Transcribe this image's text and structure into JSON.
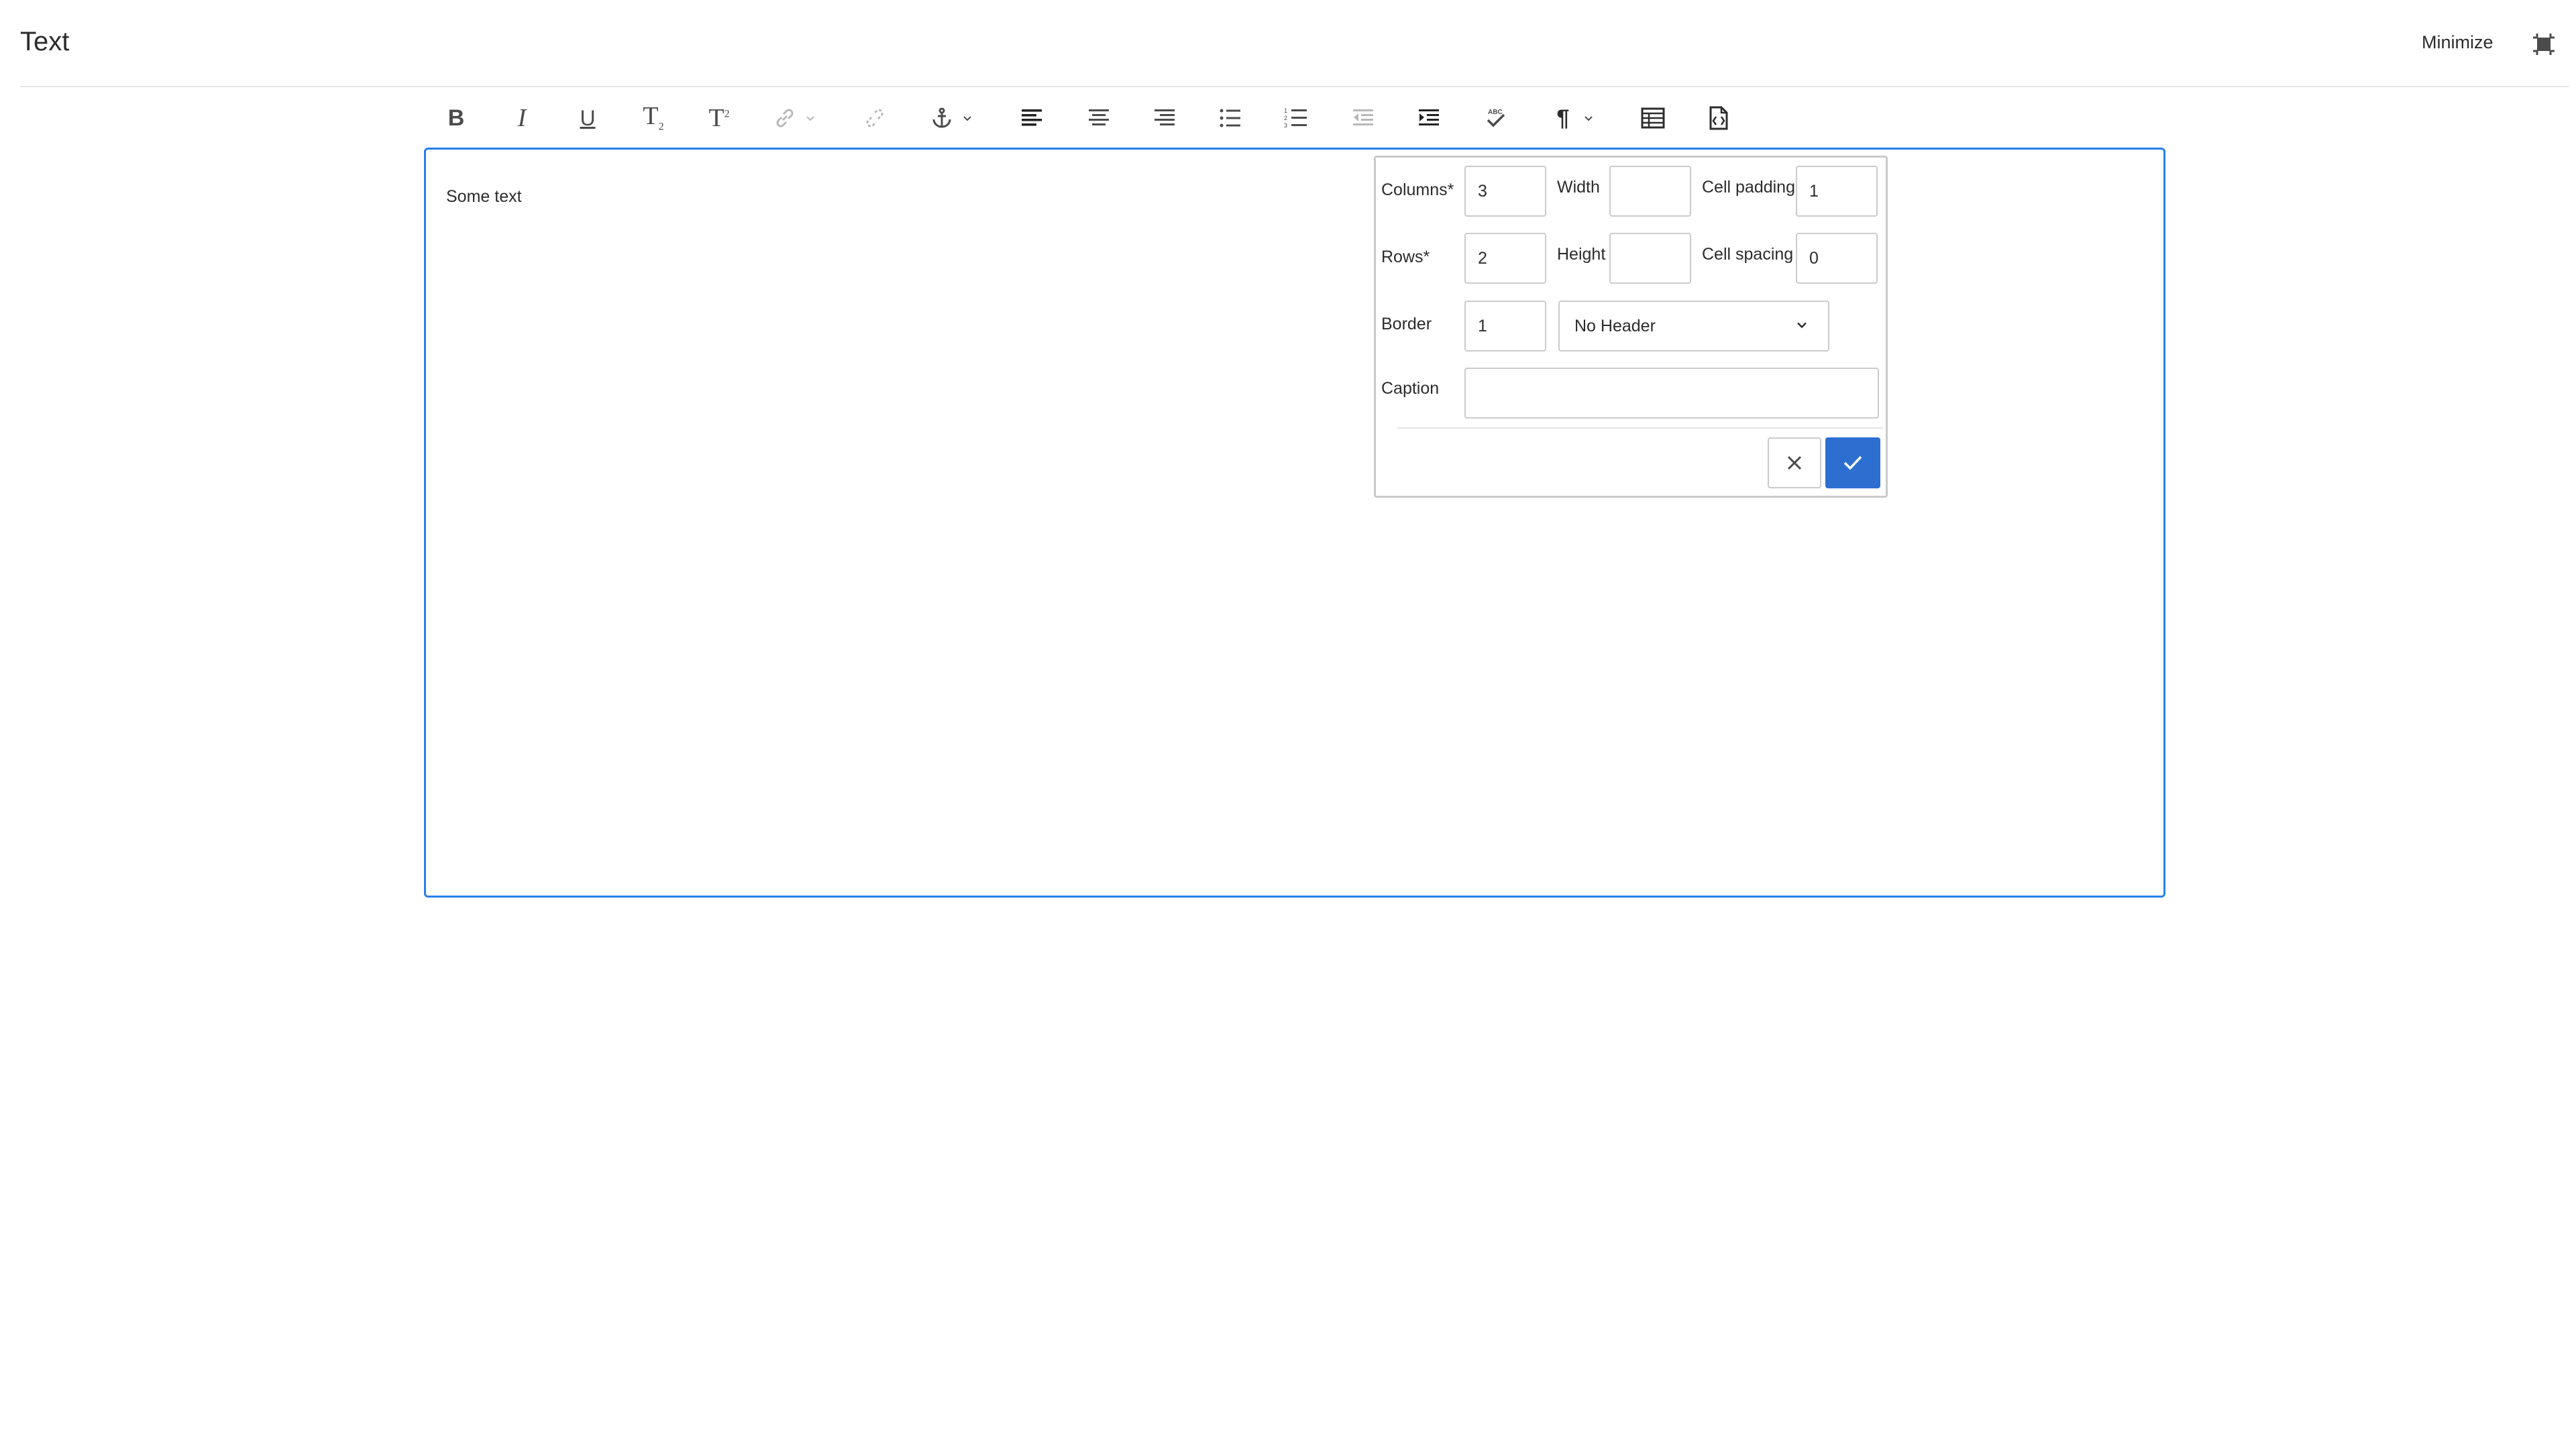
{
  "header": {
    "title": "Text",
    "minimize_label": "Minimize",
    "fullscreen_icon": "fullscreen-exit-icon"
  },
  "toolbar": {
    "buttons": [
      {
        "name": "bold",
        "icon": "bold-icon",
        "glyph": "B"
      },
      {
        "name": "italic",
        "icon": "italic-icon",
        "glyph": "I"
      },
      {
        "name": "underline",
        "icon": "underline-icon",
        "glyph": "U"
      },
      {
        "name": "subscript",
        "icon": "subscript-icon",
        "glyph": "T",
        "sub": "2"
      },
      {
        "name": "superscript",
        "icon": "superscript-icon",
        "glyph": "T",
        "sup": "2"
      },
      {
        "name": "link",
        "icon": "link-icon",
        "disabled": true
      },
      {
        "name": "unlink",
        "icon": "unlink-icon",
        "disabled": true
      },
      {
        "name": "anchor",
        "icon": "anchor-icon"
      },
      {
        "name": "align-left",
        "icon": "align-left-icon"
      },
      {
        "name": "align-center",
        "icon": "align-center-icon"
      },
      {
        "name": "align-right",
        "icon": "align-right-icon"
      },
      {
        "name": "bullet-list",
        "icon": "bullet-list-icon"
      },
      {
        "name": "numbered-list",
        "icon": "numbered-list-icon"
      },
      {
        "name": "outdent",
        "icon": "outdent-icon",
        "disabled": true
      },
      {
        "name": "indent",
        "icon": "indent-icon"
      },
      {
        "name": "spellcheck",
        "icon": "spellcheck-icon",
        "glyph": "ABC"
      },
      {
        "name": "paragraph",
        "icon": "paragraph-icon",
        "glyph": "¶"
      },
      {
        "name": "table",
        "icon": "table-icon"
      },
      {
        "name": "source-edit",
        "icon": "source-edit-icon"
      }
    ]
  },
  "editor": {
    "content": "Some text"
  },
  "table_dialog": {
    "columns_label": "Columns*",
    "columns_value": "3",
    "width_label": "Width",
    "width_value": "",
    "cell_padding_label": "Cell padding",
    "cell_padding_value": "1",
    "rows_label": "Rows*",
    "rows_value": "2",
    "height_label": "Height",
    "height_value": "",
    "cell_spacing_label": "Cell spacing",
    "cell_spacing_value": "0",
    "border_label": "Border",
    "border_value": "1",
    "header_select": "No Header",
    "caption_label": "Caption",
    "caption_value": "",
    "cancel_icon": "close-icon",
    "confirm_icon": "checkmark-icon"
  },
  "colors": {
    "accent": "#2680eb",
    "confirm": "#2d6fd0",
    "icon": "#4b4b4b",
    "icon_disabled": "#b8b8b8"
  }
}
